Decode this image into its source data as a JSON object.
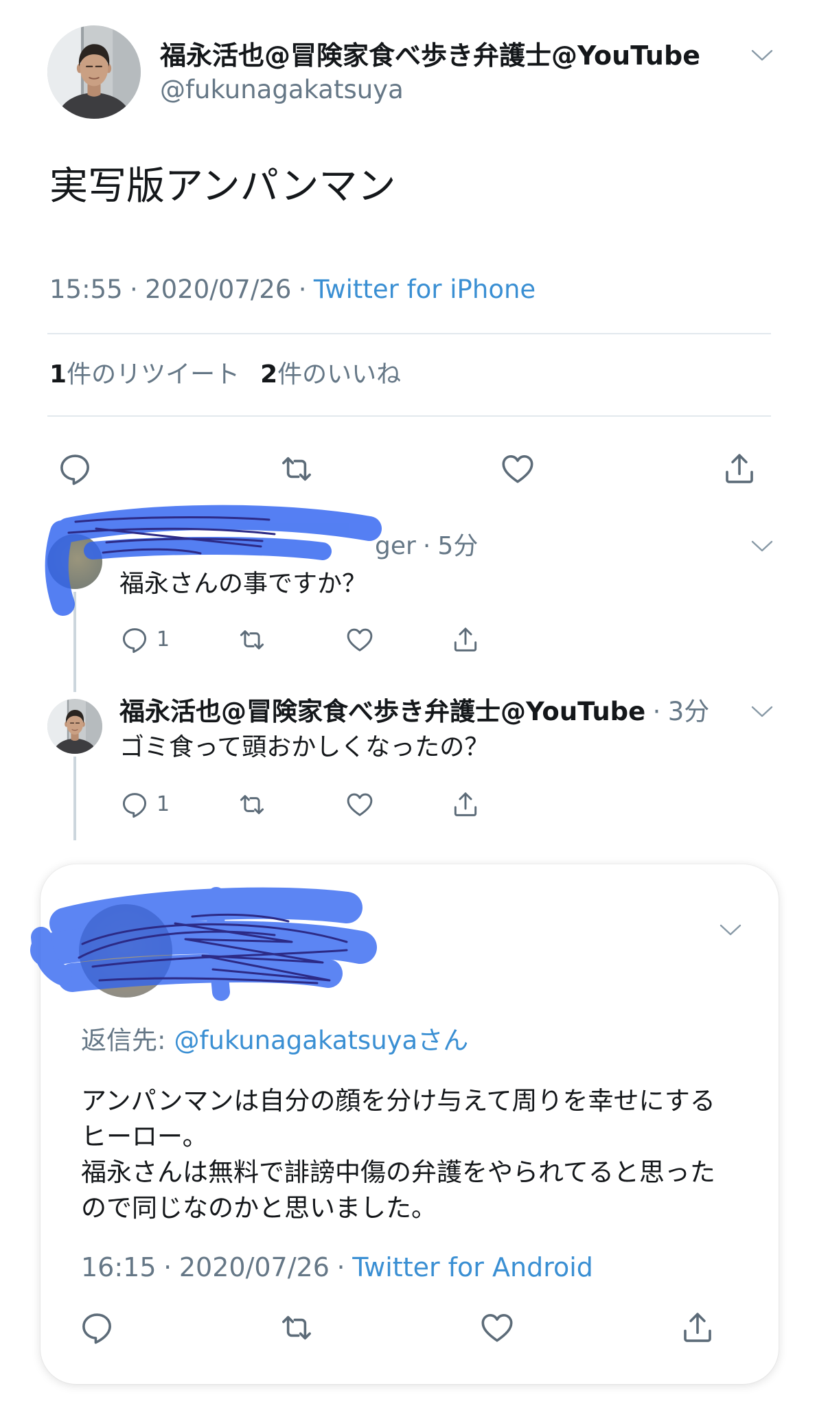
{
  "colors": {
    "text": "#14171a",
    "muted": "#657786",
    "link": "#3a8fd3",
    "divider": "#e1e8ed",
    "thread_line": "#ccd6dd",
    "icon": "#5c6b78",
    "redaction_blue": "#2f63f0"
  },
  "icons": {
    "more": "chevron-down-icon",
    "reply": "reply-icon",
    "retweet": "retweet-icon",
    "like": "heart-icon",
    "share": "share-icon"
  },
  "separator": "·",
  "tweet": {
    "author": {
      "name": "福永活也@冒険家食べ歩き弁護士@YouTube",
      "handle": "@fukunagakatsuya"
    },
    "text": "実写版アンパンマン",
    "time": "15:55",
    "date": "2020/07/26",
    "source": "Twitter for iPhone",
    "stats": {
      "retweets": {
        "count": "1",
        "label": "件のリツイート"
      },
      "likes": {
        "count": "2",
        "label": "件のいいね"
      }
    }
  },
  "replies": [
    {
      "handle_visible": "ger",
      "time": "5分",
      "text": "福永さんの事ですか？",
      "reply_count": "1"
    },
    {
      "name": "福永活也@冒険家食べ歩き弁護士@YouTube",
      "time": "3分",
      "text": "ゴミ食って頭おかしくなったの？",
      "reply_count": "1"
    }
  ],
  "focused_reply": {
    "reply_to": {
      "label": "返信先:",
      "handle": "@fukunagakatsuya",
      "suffix": "さん"
    },
    "lines": [
      "アンパンマンは自分の顔を分け与えて周りを幸せにする",
      "ヒーロー。",
      "福永さんは無料で誹謗中傷の弁護をやられてると思った",
      "ので同じなのかと思いました。"
    ],
    "time": "16:15",
    "date": "2020/07/26",
    "source": "Twitter for Android"
  }
}
